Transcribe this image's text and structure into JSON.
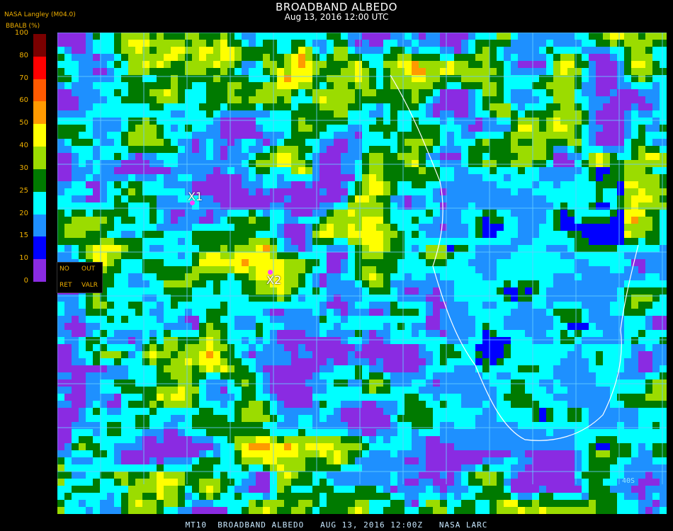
{
  "header": {
    "title": "BROADBAND ALBEDO",
    "subtitle": "Aug 13, 2016 12:00 UTC",
    "org": "NASA Langley (M04.0)",
    "unit": "BBALB (%)"
  },
  "legend": {
    "labels": [
      "100",
      "80",
      "70",
      "60",
      "50",
      "40",
      "30",
      "25",
      "20",
      "15",
      "10",
      "0"
    ],
    "colors": [
      "#7a0000",
      "#ff0000",
      "#ff5a00",
      "#ff9a00",
      "#ffff00",
      "#9bdc00",
      "#007a00",
      "#00ffff",
      "#1e90ff",
      "#0000ff",
      "#8a2be2"
    ]
  },
  "options": {
    "no": "NO",
    "out": "OUT",
    "ret": "RET",
    "valr": "VALR"
  },
  "markers": {
    "x1": "X1",
    "x2": "X2"
  },
  "map_labels": {
    "lat_40s": "40S"
  },
  "footer": "MT10  BROADBAND ALBEDO   AUG 13, 2016 12:00Z   NASA LARC",
  "colors": {
    "grid": "#66ccff",
    "ocean_clear": "#8a2be2",
    "land_clear": "#00ffff",
    "coast": "#ffffff"
  }
}
